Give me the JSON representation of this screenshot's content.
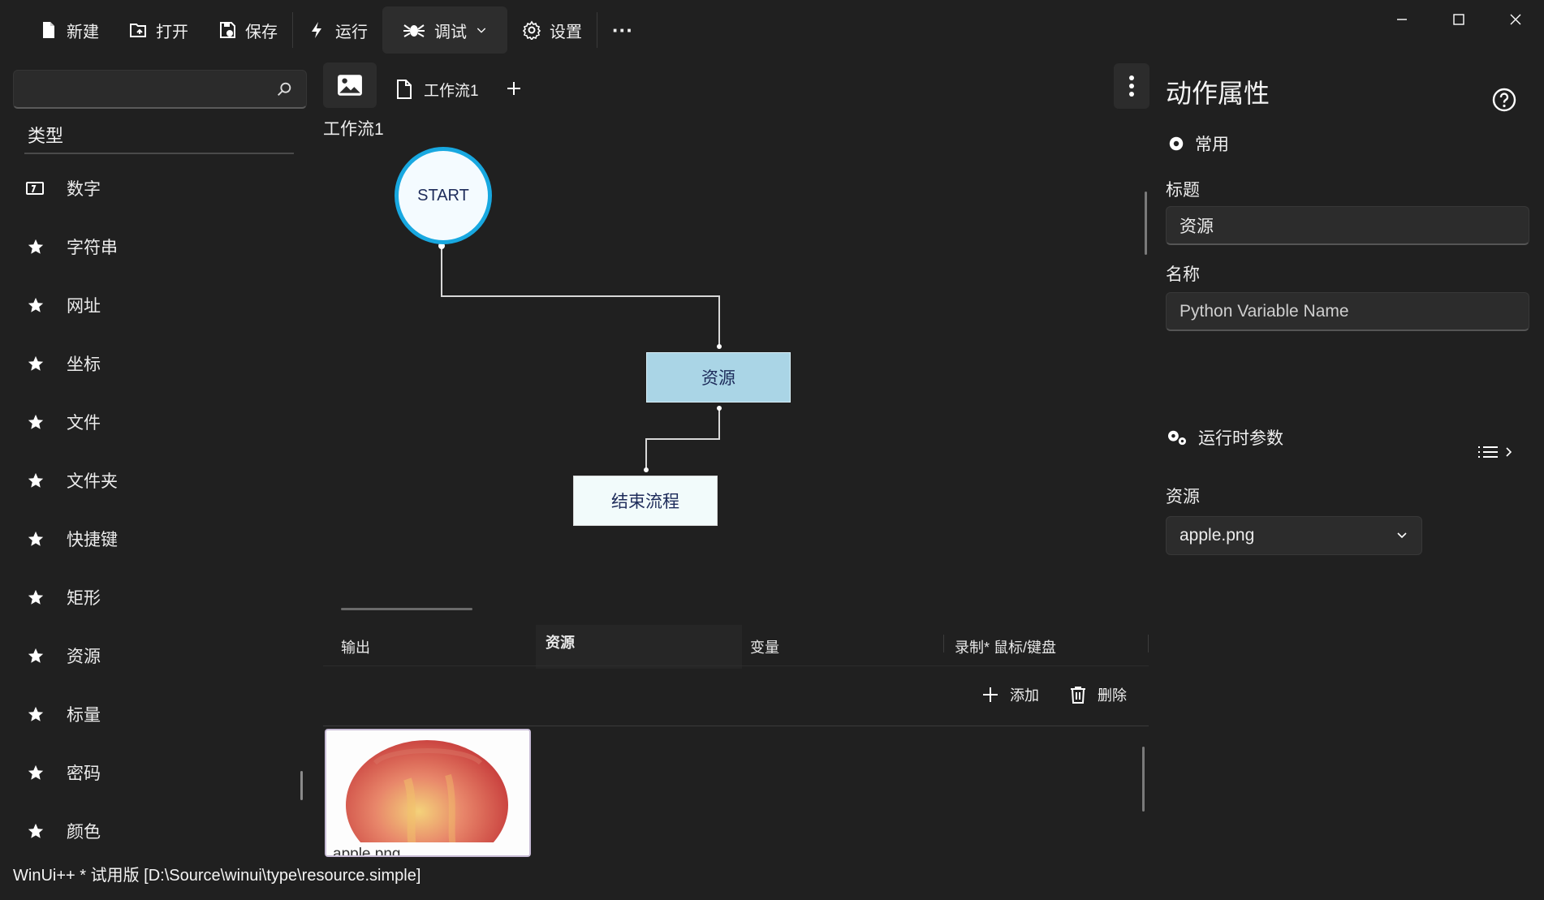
{
  "toolbar": {
    "new_label": "新建",
    "open_label": "打开",
    "save_label": "保存",
    "run_label": "运行",
    "debug_label": "调试",
    "settings_label": "设置",
    "more_label": "···"
  },
  "left_panel": {
    "search_placeholder": "",
    "category_header": "类型",
    "types": [
      {
        "label": "数字",
        "icon": "number-icon"
      },
      {
        "label": "字符串",
        "icon": "star-icon"
      },
      {
        "label": "网址",
        "icon": "star-icon"
      },
      {
        "label": "坐标",
        "icon": "star-icon"
      },
      {
        "label": "文件",
        "icon": "star-icon"
      },
      {
        "label": "文件夹",
        "icon": "star-icon"
      },
      {
        "label": "快捷键",
        "icon": "star-icon"
      },
      {
        "label": "矩形",
        "icon": "star-icon"
      },
      {
        "label": "资源",
        "icon": "star-icon"
      },
      {
        "label": "标量",
        "icon": "star-icon"
      },
      {
        "label": "密码",
        "icon": "star-icon"
      },
      {
        "label": "颜色",
        "icon": "star-icon"
      }
    ]
  },
  "doc": {
    "tab_label": "工作流1",
    "workflow_label": "工作流1"
  },
  "canvas": {
    "start_node": "START",
    "resource_node": "资源",
    "end_node": "结束流程",
    "colors": {
      "start_border": "#18a8e0",
      "resource_fill": "#aad5e6",
      "end_fill": "#f2fbfb"
    }
  },
  "bottom": {
    "tabs": [
      "输出",
      "资源",
      "变量",
      "录制* 鼠标/键盘"
    ],
    "active_tab": "资源",
    "add_label": "添加",
    "delete_label": "删除",
    "resource_file": "apple.png"
  },
  "status_bar": {
    "text": "WinUi++ * 试用版 [D:\\Source\\winui\\type\\resource.simple]"
  },
  "props": {
    "title": "动作属性",
    "common_header": "常用",
    "title_label": "标题",
    "title_value": "资源",
    "name_label": "名称",
    "name_placeholder": "Python Variable Name",
    "runtime_header": "运行时参数",
    "resource_label": "资源",
    "resource_value": "apple.png"
  }
}
